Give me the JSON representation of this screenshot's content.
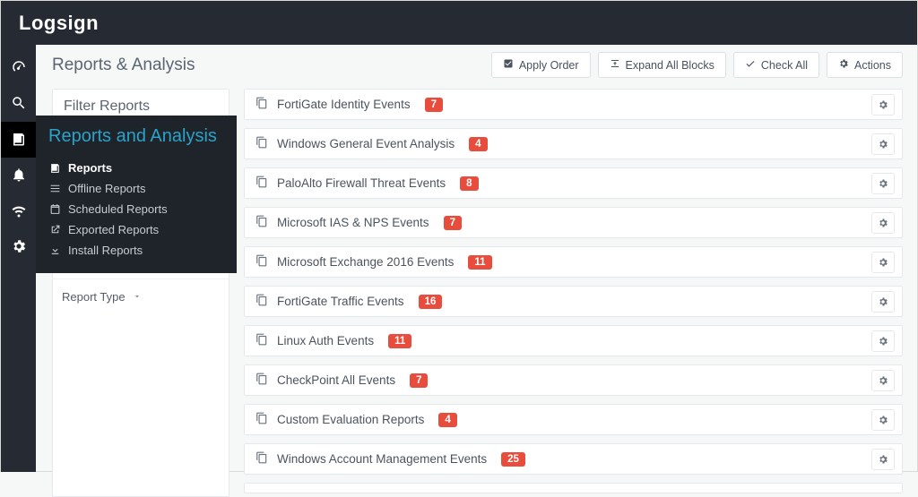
{
  "brand": "Logsign",
  "page": {
    "title": "Reports & Analysis"
  },
  "header_buttons": {
    "apply_order": "Apply Order",
    "expand_all": "Expand All Blocks",
    "check_all": "Check All",
    "actions": "Actions"
  },
  "filter": {
    "title": "Filter Reports",
    "report_type": "Report Type"
  },
  "flyout": {
    "title": "Reports and Analysis",
    "items": [
      {
        "label": "Reports",
        "current": true
      },
      {
        "label": "Offline Reports",
        "current": false
      },
      {
        "label": "Scheduled Reports",
        "current": false
      },
      {
        "label": "Exported Reports",
        "current": false
      },
      {
        "label": "Install Reports",
        "current": false
      }
    ]
  },
  "reports": [
    {
      "label": "FortiGate Identity Events",
      "count": 7
    },
    {
      "label": "Windows General Event Analysis",
      "count": 4
    },
    {
      "label": "PaloAlto Firewall Threat Events",
      "count": 8
    },
    {
      "label": "Microsoft IAS & NPS Events",
      "count": 7
    },
    {
      "label": "Microsoft Exchange 2016 Events",
      "count": 11
    },
    {
      "label": "FortiGate Traffic Events",
      "count": 16
    },
    {
      "label": "Linux Auth Events",
      "count": 11
    },
    {
      "label": "CheckPoint All Events",
      "count": 7
    },
    {
      "label": "Custom Evaluation Reports",
      "count": 4
    },
    {
      "label": "Windows Account Management Events",
      "count": 25
    }
  ]
}
